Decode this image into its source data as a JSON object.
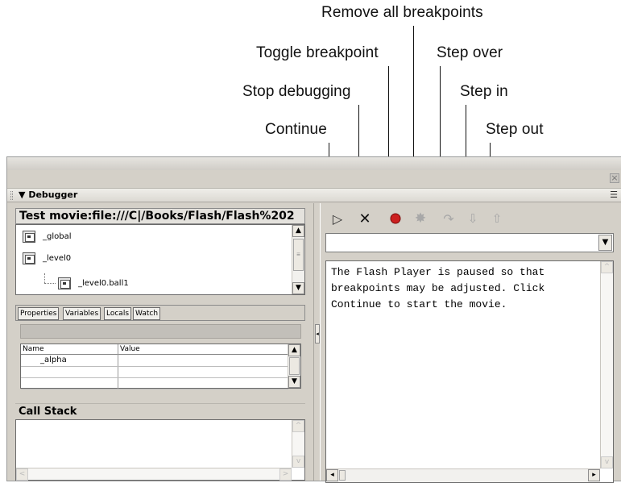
{
  "callouts": {
    "remove_all": "Remove all breakpoints",
    "toggle": "Toggle breakpoint",
    "step_over": "Step over",
    "stop": "Stop debugging",
    "step_in": "Step in",
    "continue": "Continue",
    "step_out": "Step out"
  },
  "panel": {
    "title": "Debugger",
    "close_glyph": "×",
    "menu_glyph": "☰"
  },
  "left": {
    "movie_path": "Test movie:file:///C|/Books/Flash/Flash%202",
    "tree_items": [
      "_global",
      "_level0",
      "_level0.ball1"
    ],
    "tabs": [
      "Properties",
      "Variables",
      "Locals",
      "Watch"
    ],
    "grid": {
      "headers": [
        "Name",
        "Value"
      ],
      "rows": [
        {
          "name": "_alpha",
          "value": ""
        }
      ]
    },
    "call_stack_title": "Call Stack"
  },
  "right": {
    "toolbar": {
      "continue_icon": "▷",
      "stop_icon": "✕",
      "toggle_icon": "●",
      "remove_icon": "✸",
      "step_over_icon": "↷",
      "step_in_icon": "⇩",
      "step_out_icon": "⇧"
    },
    "script_select_value": "",
    "message": "The Flash Player is paused so that breakpoints may be adjusted. Click Continue to start the movie."
  },
  "colors": {
    "panel_bg": "#d4d0c8",
    "record_red": "#cc2020",
    "disabled_gray": "#a8a8a8"
  }
}
